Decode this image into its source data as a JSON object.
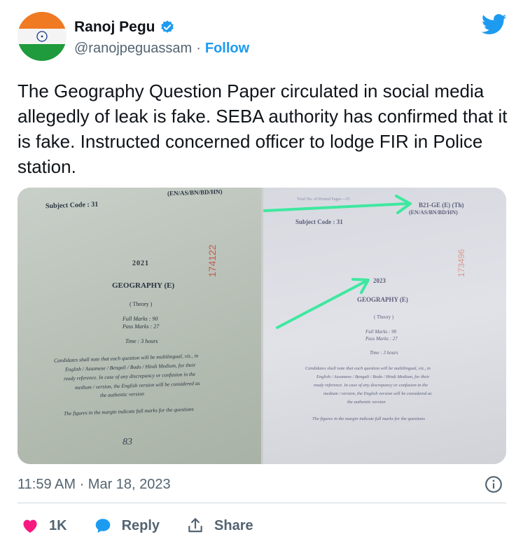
{
  "author": {
    "name": "Ranoj Pegu",
    "handle": "@ranojpeguassam",
    "separator": "·",
    "follow_label": "Follow"
  },
  "tweet_text": "The Geography Question Paper circulated in social media allegedly of leak is fake. SEBA authority has confirmed that it is fake. Instructed concerned officer to lodge FIR in Police station.",
  "left_photo": {
    "code_line": "(EN/AS/BN/BD/HN)",
    "subject_code": "Subject Code : 31",
    "serial": "174122",
    "year": "2021",
    "subject": "GEOGRAPHY (E)",
    "theory": "( Theory )",
    "full_marks": "Full Marks : 90",
    "pass_marks": "Pass Marks : 27",
    "time": "Time : 3 hours",
    "note_lines": [
      "Candidates shall note that each question will be multilingual, viz., in",
      "English / Assamese / Bengali / Bodo / Hindi Medium, for their",
      "ready reference. In case of any discrepancy or confusion in the",
      "medium / version, the English version will be considered as",
      "the authentic version"
    ],
    "figures_note": "The figures in the margin indicate full marks for the questions",
    "handwritten": "83"
  },
  "right_photo": {
    "printed_pages": "Total No. of Printed Pages—15",
    "paper_code": "B21-GE (E) (Th)",
    "code_line": "(EN/AS/BN/BD/HN)",
    "subject_code": "Subject Code : 31",
    "serial": "173496",
    "year": "2023",
    "subject": "GEOGRAPHY (E)",
    "theory": "( Theory )",
    "full_marks": "Full Marks : 90",
    "pass_marks": "Pass Marks : 27",
    "time": "Time : 3 hours",
    "note_lines": [
      "Candidates shall note that each question will be multilingual, viz., in",
      "English / Assamese / Bengali / Bodo / Hindi Medium, for their",
      "ready reference. In case of any discrepancy or confusion in the",
      "medium / version, the English version will be considered as",
      "the authentic version"
    ],
    "figures_note": "The figures in the margin indicate full marks for the questions"
  },
  "timestamp": "11:59 AM · Mar 18, 2023",
  "actions": {
    "likes": "1K",
    "reply_label": "Reply",
    "share_label": "Share"
  },
  "colors": {
    "link": "#1d9bf0",
    "like": "#f91880",
    "arrow": "#3ee8a0",
    "secondary_text": "#536471"
  }
}
